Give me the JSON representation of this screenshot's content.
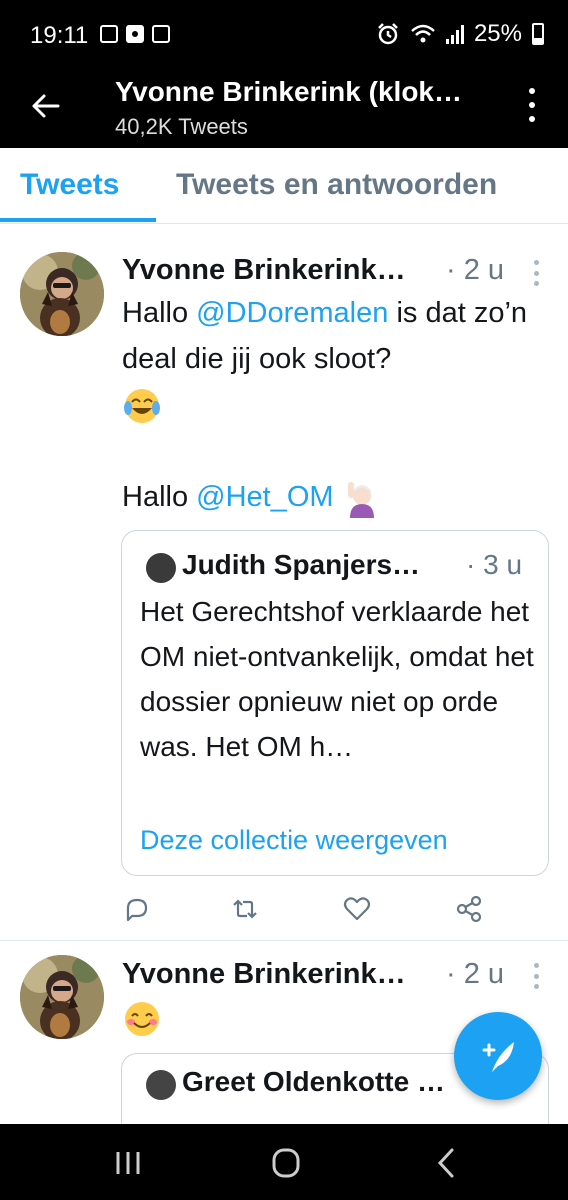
{
  "status_bar": {
    "time": "19:11",
    "battery": "25%"
  },
  "header": {
    "title": "Yvonne Brinkerink (klok…",
    "subtitle": "40,2K Tweets"
  },
  "tabs": [
    {
      "label": "Tweets",
      "active": true
    },
    {
      "label": "Tweets en antwoorden",
      "active": false
    }
  ],
  "tweets": [
    {
      "author": "Yvonne Brinkerink…",
      "time": "· 2 u",
      "text_parts": {
        "line1_pre": "Hallo ",
        "mention1": "@DDoremalen",
        "line1_post": " is dat zo’n deal die jij ook sloot?",
        "line2_pre": "Hallo ",
        "mention2": "@Het_OM"
      },
      "emojis": [
        "face-with-tears-of-joy",
        "person-raising-hand"
      ],
      "quote": {
        "author": "Judith Spanjers…",
        "time": "· 3 u",
        "text": "Het Gerechtshof verklaarde het OM niet-ontvankelijk, omdat het dossier opnieuw niet op orde was. Het OM h…",
        "link": "Deze collectie weergeven"
      }
    },
    {
      "author": "Yvonne Brinkerink…",
      "time": "· 2 u",
      "emojis": [
        "smiling-face-with-smiling-eyes"
      ],
      "quote": {
        "author": "Greet Oldenkotte …",
        "time": ""
      }
    }
  ],
  "icons": {
    "back": "arrow-left-icon",
    "more": "more-vertical-icon",
    "reply": "reply-icon",
    "retweet": "retweet-icon",
    "like": "heart-icon",
    "share": "share-icon",
    "compose": "compose-icon"
  },
  "colors": {
    "accent": "#1da1f2",
    "header_bg": "#000000",
    "secondary_text": "#657786"
  }
}
